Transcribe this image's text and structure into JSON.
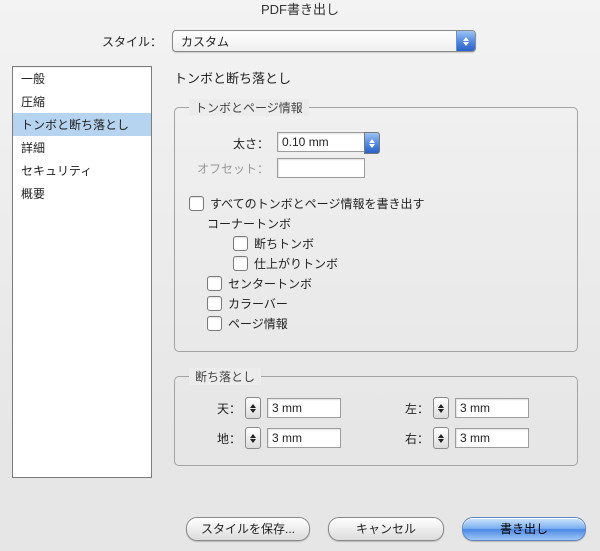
{
  "window_title": "PDF書き出し",
  "style_label": "スタイル：",
  "style_select_value": "カスタム",
  "sidebar": {
    "items": [
      {
        "label": "一般"
      },
      {
        "label": "圧縮"
      },
      {
        "label": "トンボと断ち落とし"
      },
      {
        "label": "詳細"
      },
      {
        "label": "セキュリティ"
      },
      {
        "label": "概要"
      }
    ],
    "selected_index": 2
  },
  "section_title": "トンボと断ち落とし",
  "group_marks": {
    "legend": "トンボとページ情報",
    "thickness_label": "太さ：",
    "thickness_value": "0.10 mm",
    "offset_label": "オフセット：",
    "offset_value": "",
    "all_marks": "すべてのトンボとページ情報を書き出す",
    "corner_marks": "コーナートンボ",
    "trim_marks": "断ちトンボ",
    "finish_marks": "仕上がりトンボ",
    "center_marks": "センタートンボ",
    "color_bars": "カラーバー",
    "page_info": "ページ情報"
  },
  "group_bleed": {
    "legend": "断ち落とし",
    "top_label": "天：",
    "bottom_label": "地：",
    "left_label": "左：",
    "right_label": "右：",
    "top_value": "3 mm",
    "bottom_value": "3 mm",
    "left_value": "3 mm",
    "right_value": "3 mm"
  },
  "buttons": {
    "save_style": "スタイルを保存...",
    "cancel": "キャンセル",
    "export": "書き出し"
  }
}
